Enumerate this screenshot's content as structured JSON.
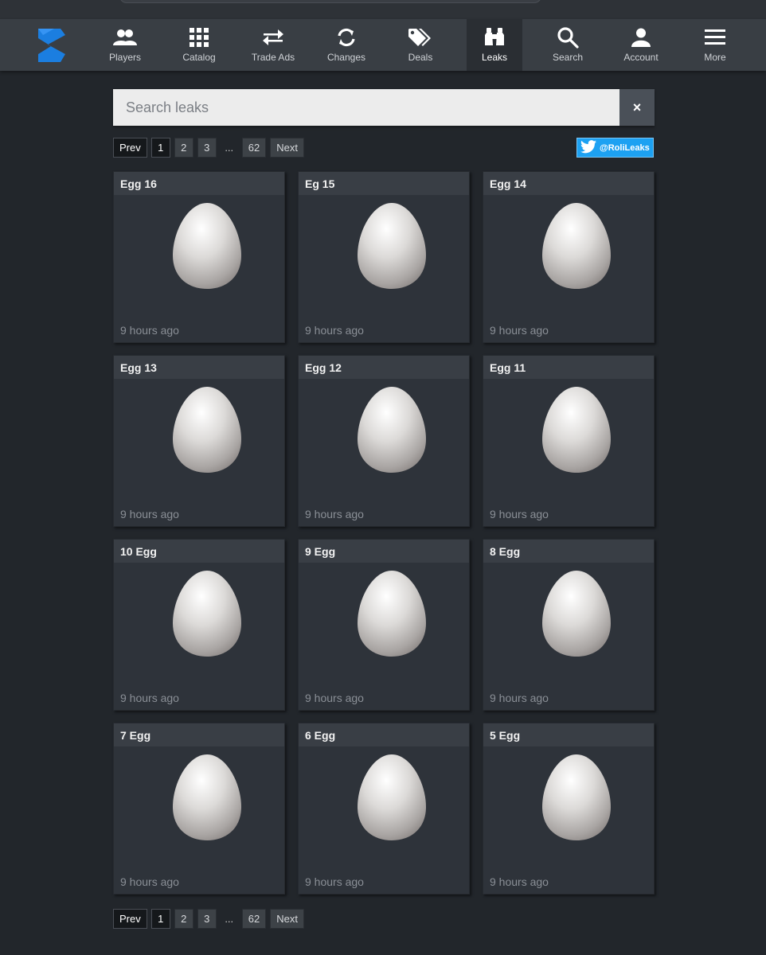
{
  "nav": {
    "items": [
      {
        "label": "Players",
        "icon": "players-icon"
      },
      {
        "label": "Catalog",
        "icon": "grid-icon"
      },
      {
        "label": "Trade Ads",
        "icon": "swap-icon"
      },
      {
        "label": "Changes",
        "icon": "refresh-icon"
      },
      {
        "label": "Deals",
        "icon": "tags-icon"
      },
      {
        "label": "Leaks",
        "icon": "binoculars-icon",
        "active": true
      },
      {
        "label": "Search",
        "icon": "search-icon"
      },
      {
        "label": "Account",
        "icon": "user-icon"
      },
      {
        "label": "More",
        "icon": "menu-icon"
      }
    ],
    "brand_color": "#1b7ee0"
  },
  "search": {
    "placeholder": "Search leaks",
    "value": "",
    "clear_label": "×"
  },
  "pagination": {
    "prev": "Prev",
    "pages": [
      "1",
      "2",
      "3"
    ],
    "ellipsis": "...",
    "last": "62",
    "next": "Next",
    "current": "1"
  },
  "twitter": {
    "handle": "@RoliLeaks",
    "color": "#1da1f2"
  },
  "leaks": [
    {
      "title": "Egg 16",
      "time": "9 hours ago"
    },
    {
      "title": "Eg 15",
      "time": "9 hours ago"
    },
    {
      "title": "Egg 14",
      "time": "9 hours ago"
    },
    {
      "title": "Egg 13",
      "time": "9 hours ago"
    },
    {
      "title": "Egg 12",
      "time": "9 hours ago"
    },
    {
      "title": "Egg 11",
      "time": "9 hours ago"
    },
    {
      "title": "10 Egg",
      "time": "9 hours ago"
    },
    {
      "title": "9 Egg",
      "time": "9 hours ago"
    },
    {
      "title": "8 Egg",
      "time": "9 hours ago"
    },
    {
      "title": "7 Egg",
      "time": "9 hours ago"
    },
    {
      "title": "6 Egg",
      "time": "9 hours ago"
    },
    {
      "title": "5 Egg",
      "time": "9 hours ago"
    }
  ]
}
